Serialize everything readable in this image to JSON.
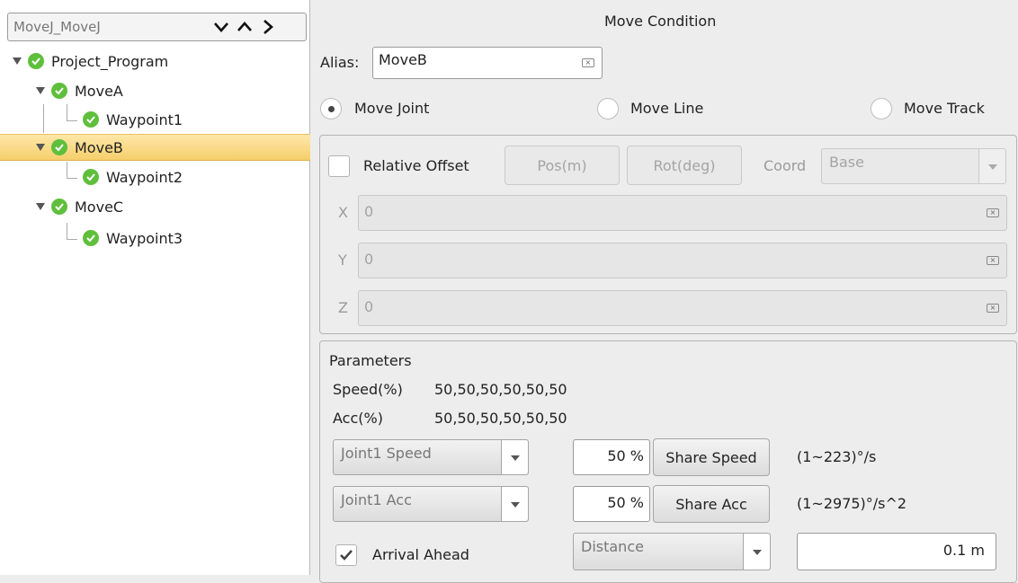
{
  "tree": {
    "header": "MoveJ_MoveJ",
    "nodes": [
      {
        "label": "Project_Program"
      },
      {
        "label": "MoveA"
      },
      {
        "label": "Waypoint1"
      },
      {
        "label": "MoveB"
      },
      {
        "label": "Waypoint2"
      },
      {
        "label": "MoveC"
      },
      {
        "label": "Waypoint3"
      }
    ]
  },
  "move_condition": {
    "title": "Move Condition",
    "alias_label": "Alias:",
    "alias_value": "MoveB",
    "radios": [
      {
        "label": "Move Joint",
        "checked": true
      },
      {
        "label": "Move Line",
        "checked": false
      },
      {
        "label": "Move Track",
        "checked": false
      }
    ]
  },
  "offset": {
    "relative_offset_label": "Relative Offset",
    "relative_offset_checked": false,
    "pos_button": "Pos(m)",
    "rot_button": "Rot(deg)",
    "coord_label": "Coord",
    "coord_value": "Base",
    "fields": [
      {
        "label": "X",
        "value": "0"
      },
      {
        "label": "Y",
        "value": "0"
      },
      {
        "label": "Z",
        "value": "0"
      }
    ]
  },
  "parameters": {
    "title": "Parameters",
    "speed_label": "Speed(%)",
    "speed_value": "50,50,50,50,50,50",
    "acc_label": "Acc(%)",
    "acc_value": "50,50,50,50,50,50",
    "joint_speed_select": "Joint1 Speed",
    "joint_speed_pct": "50 %",
    "share_speed_button": "Share Speed",
    "speed_range": "(1~223)°/s",
    "joint_acc_select": "Joint1 Acc",
    "joint_acc_pct": "50 %",
    "share_acc_button": "Share Acc",
    "acc_range": "(1~2975)°/s^2",
    "arrival_ahead_label": "Arrival Ahead",
    "arrival_ahead_checked": true,
    "arrival_mode": "Distance",
    "arrival_value": "0.1 m"
  },
  "colors": {
    "check_green": "#5fbf3c",
    "selection_yellow": "#f6cf6c"
  }
}
